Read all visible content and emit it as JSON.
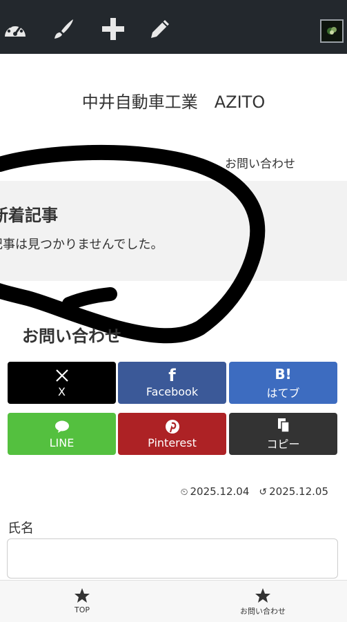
{
  "admin_bar": {
    "icons": [
      "dashboard-icon",
      "brush-icon",
      "plus-icon",
      "pencil-icon"
    ],
    "background": "#23282d"
  },
  "site": {
    "title": "中井自動車工業　AZITO"
  },
  "nav": {
    "contact_link": "お問い合わせ"
  },
  "widget": {
    "title": "新着記事",
    "message": "記事は見つかりませんでした。"
  },
  "page": {
    "heading": "お問い合わせ"
  },
  "share": [
    {
      "label": "X",
      "color": "#000000",
      "icon": "x-icon"
    },
    {
      "label": "Facebook",
      "color": "#3b5998",
      "icon": "facebook-icon"
    },
    {
      "label": "はてブ",
      "color": "#3d6cc0",
      "icon": "hatena-icon"
    },
    {
      "label": "LINE",
      "color": "#54c03f",
      "icon": "line-icon"
    },
    {
      "label": "Pinterest",
      "color": "#ad2225",
      "icon": "pinterest-icon"
    },
    {
      "label": "コピー",
      "color": "#333333",
      "icon": "copy-icon"
    }
  ],
  "dates": {
    "published": "2025.12.04",
    "updated": "2025.12.05"
  },
  "form": {
    "name_label": "氏名"
  },
  "bottom_nav": {
    "top_label": "TOP",
    "contact_label": "お問い合わせ"
  }
}
